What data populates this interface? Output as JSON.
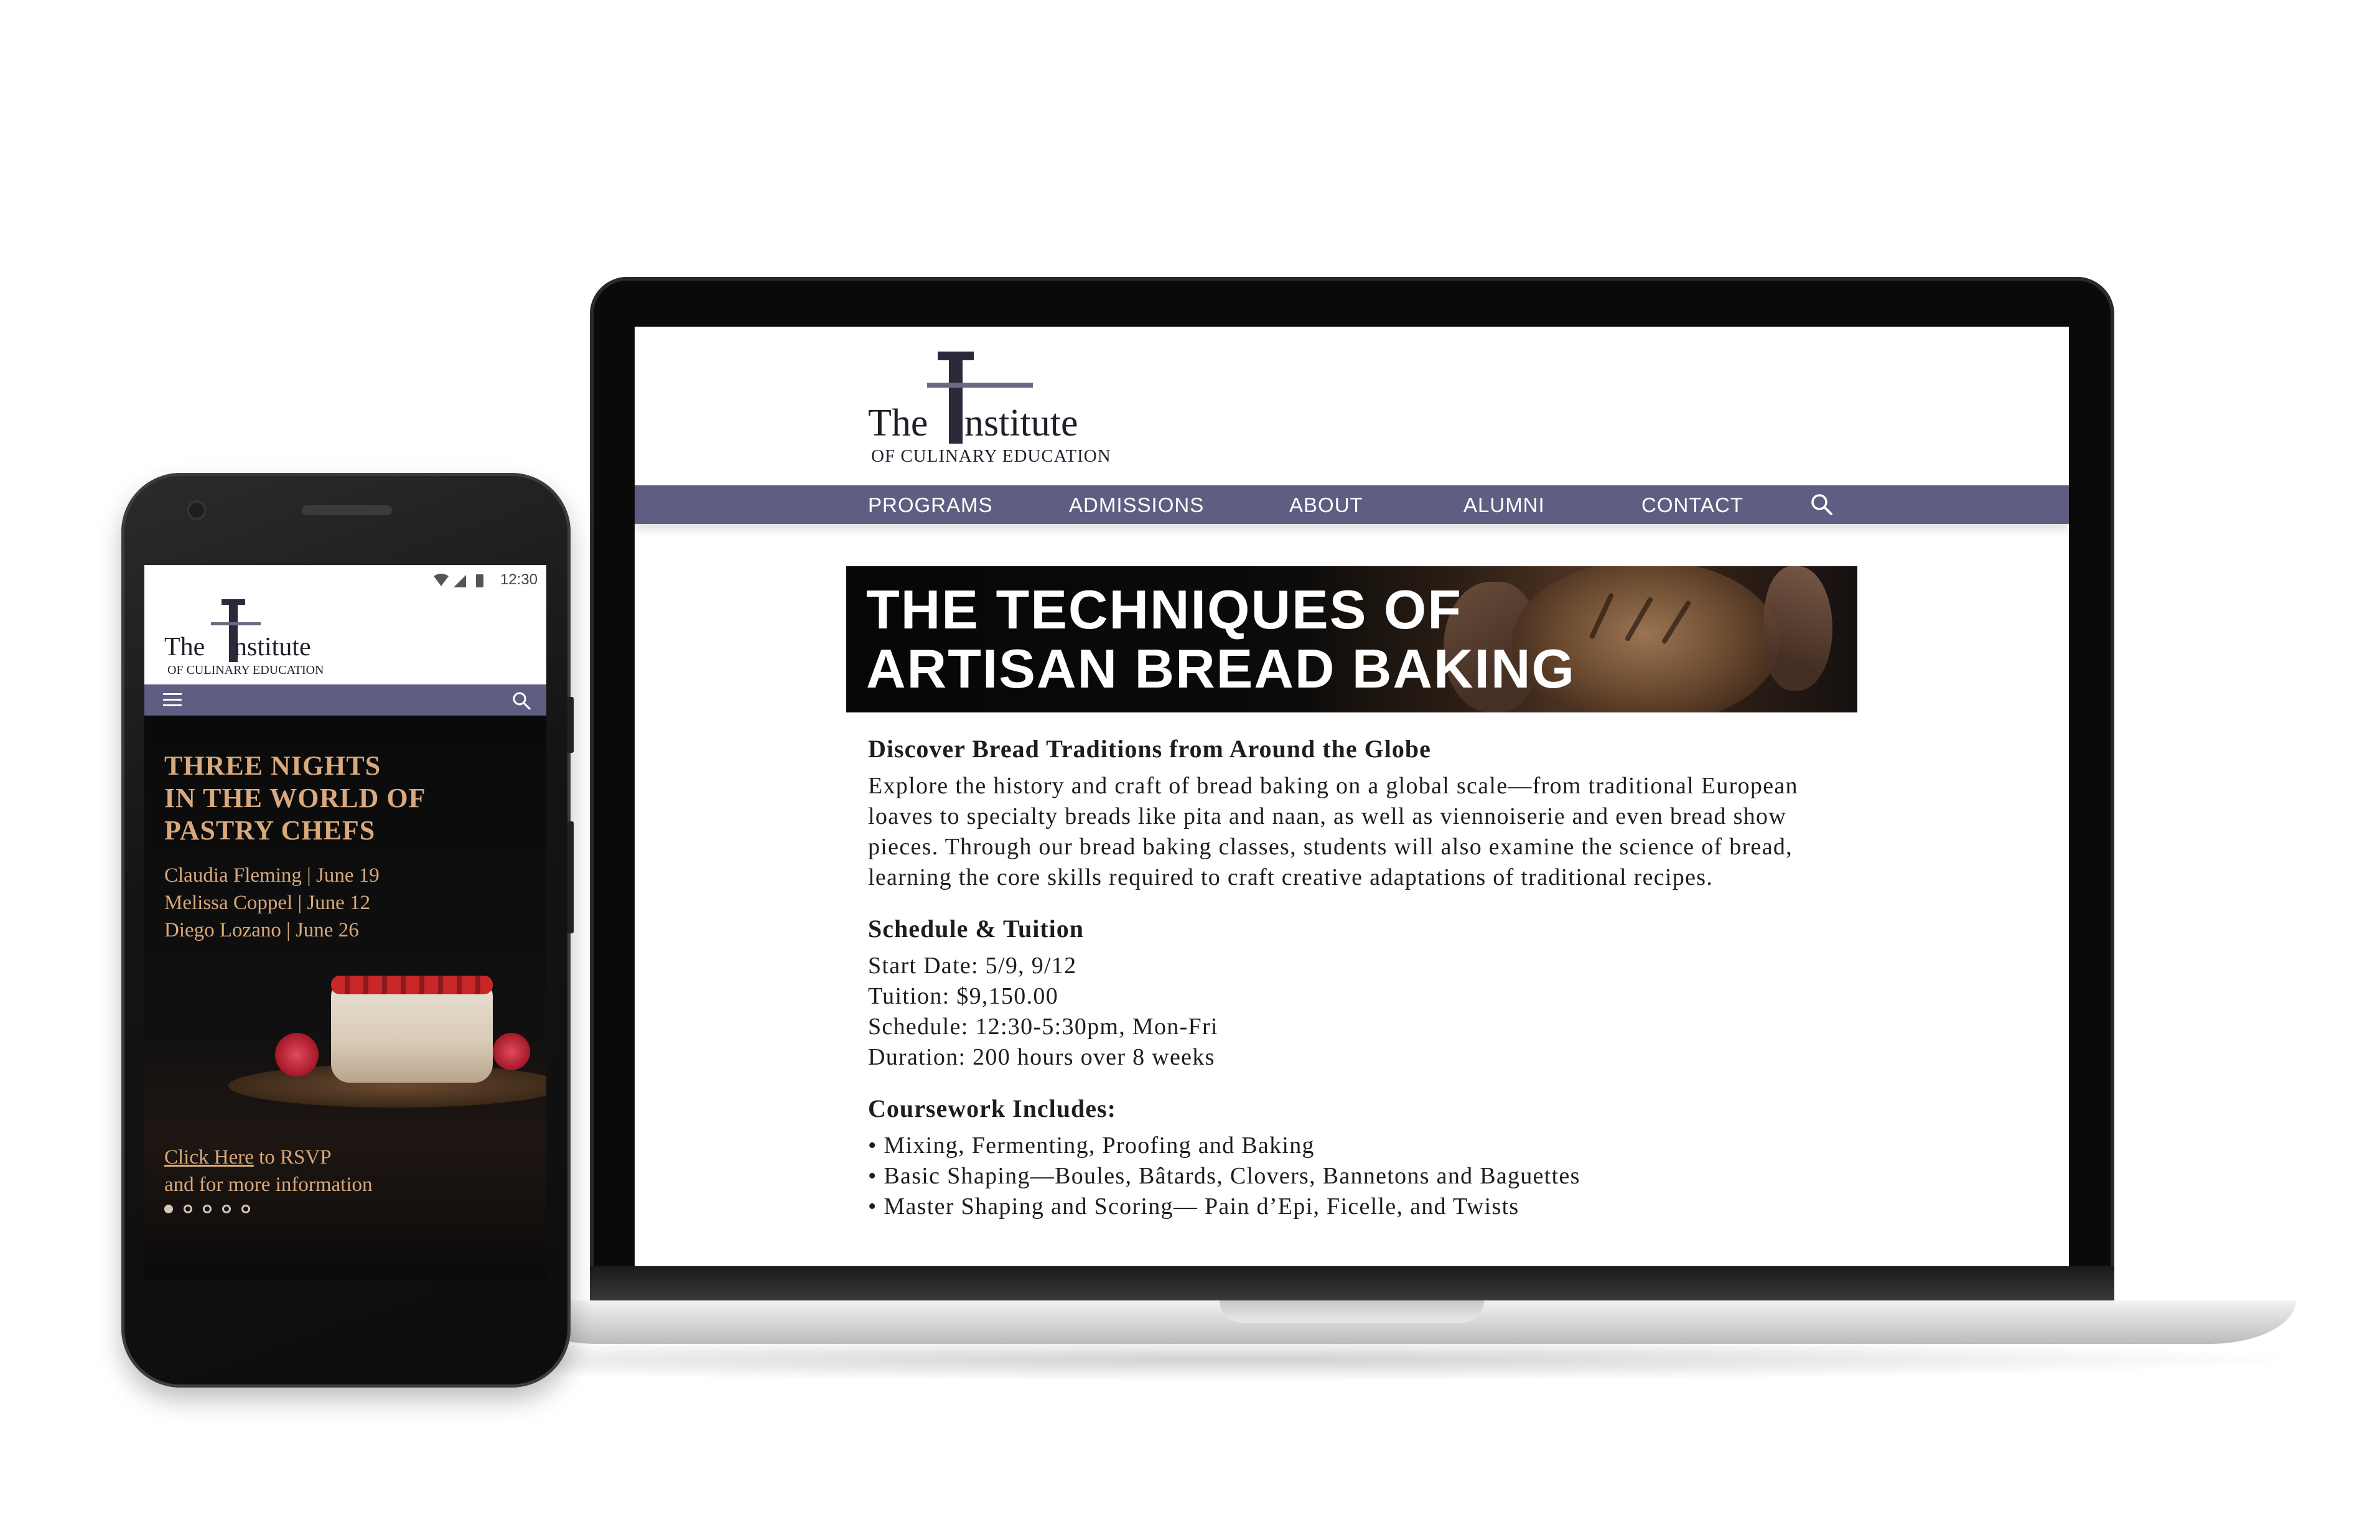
{
  "laptop_site": {
    "logo": {
      "word1": "The",
      "word2": "nstitute",
      "subtitle": "OF CULINARY EDUCATION"
    },
    "nav": {
      "items": [
        "PROGRAMS",
        "ADMISSIONS",
        "ABOUT",
        "ALUMNI",
        "CONTACT"
      ],
      "search_icon": "search-icon"
    },
    "banner": {
      "line1": "THE TECHNIQUES OF",
      "line2": "ARTISAN BREAD BAKING"
    },
    "section1": {
      "heading": "Discover Bread Traditions from Around the Globe",
      "body": "Explore the history and craft of bread baking on a global scale—from traditional European loaves to specialty breads like pita and naan, as well as viennoiserie and even bread show pieces. Through our bread baking classes, students will also examine the science of bread, learning the core skills required to craft creative adaptations of traditional recipes."
    },
    "section2": {
      "heading": "Schedule & Tuition",
      "lines": [
        "Start Date:  5/9, 9/12",
        "Tuition: $9,150.00",
        "Schedule: 12:30-5:30pm, Mon-Fri",
        "Duration: 200 hours over 8 weeks"
      ]
    },
    "section3": {
      "heading": "Coursework Includes:",
      "items": [
        "• Mixing, Fermenting, Proofing and Baking",
        "• Basic Shaping—Boules, Bâtards, Clovers, Bannetons and Baguettes",
        "• Master Shaping and Scoring— Pain d’Epi, Ficelle, and Twists"
      ]
    }
  },
  "phone_site": {
    "status": {
      "time": "12:30"
    },
    "logo": {
      "word1": "The",
      "word2": "nstitute",
      "subtitle": "OF CULINARY EDUCATION"
    },
    "nav": {
      "menu_icon": "hamburger-menu-icon",
      "search_icon": "search-icon"
    },
    "hero": {
      "title_lines": [
        "THREE NIGHTS",
        "IN THE WORLD OF",
        "PASTRY CHEFS"
      ],
      "names": [
        "Claudia Fleming | June 19",
        "Melissa Coppel | June 12",
        "Diego Lozano | June 26"
      ],
      "cta_link": "Click Here",
      "cta_rest": " to RSVP",
      "cta_line2": "and for more information",
      "carousel_active": 1,
      "carousel_total": 5
    }
  },
  "colors": {
    "nav_purple": "#5f5e82",
    "accent_gold": "#d8a97c",
    "device_black": "#0a0a0a"
  }
}
